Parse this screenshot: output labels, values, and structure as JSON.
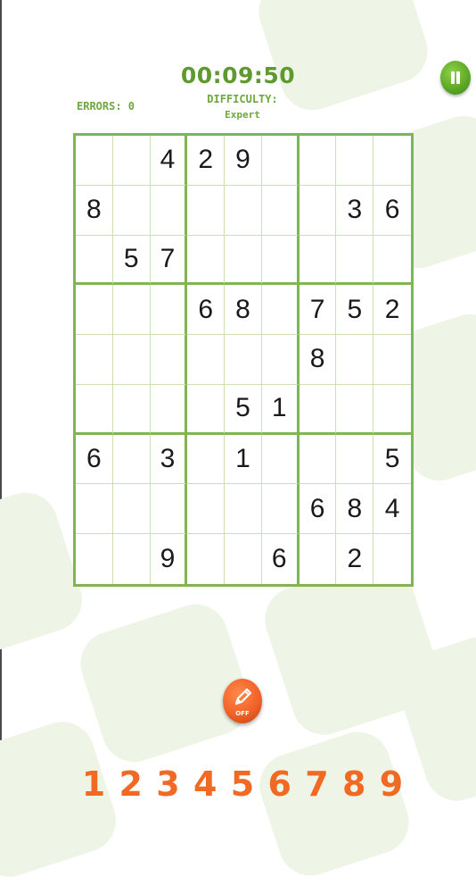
{
  "header": {
    "timer": "00:09:50",
    "errors": "ERRORS: 0",
    "difficulty_label": "DIFFICULTY:",
    "difficulty_value": "Expert"
  },
  "controls": {
    "pause_icon": "pause-icon",
    "pencil_icon": "pencil-icon",
    "pencil_state": "OFF"
  },
  "board": {
    "rows": [
      [
        "",
        "",
        "4",
        "2",
        "9",
        "",
        "",
        "",
        ""
      ],
      [
        "8",
        "",
        "",
        "",
        "",
        "",
        "",
        "3",
        "6"
      ],
      [
        "",
        "5",
        "7",
        "",
        "",
        "",
        "",
        "",
        ""
      ],
      [
        "",
        "",
        "",
        "6",
        "8",
        "",
        "7",
        "5",
        "2"
      ],
      [
        "",
        "",
        "",
        "",
        "",
        "",
        "8",
        "",
        ""
      ],
      [
        "",
        "",
        "",
        "",
        "5",
        "1",
        "",
        "",
        ""
      ],
      [
        "6",
        "",
        "3",
        "",
        "1",
        "",
        "",
        "",
        "5"
      ],
      [
        "",
        "",
        "",
        "",
        "",
        "",
        "6",
        "8",
        "4"
      ],
      [
        "",
        "",
        "9",
        "",
        "",
        "6",
        "",
        "2",
        ""
      ]
    ]
  },
  "numpad": [
    "1",
    "2",
    "3",
    "4",
    "5",
    "6",
    "7",
    "8",
    "9"
  ],
  "colors": {
    "accent_green": "#7fb552",
    "timer_green": "#5f9a2e",
    "numpad_orange": "#f06a24",
    "pause_green": "#5aa624",
    "pencil_orange": "#f0622a"
  }
}
